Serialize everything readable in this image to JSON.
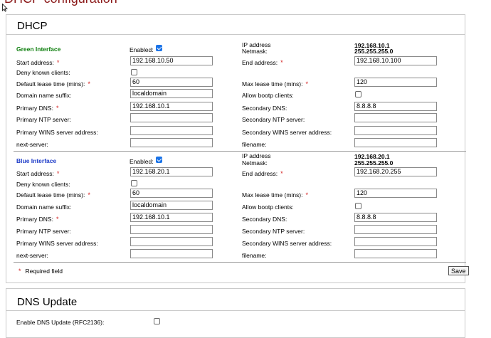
{
  "page_title": "DHCP configuration",
  "dhcp_box": {
    "title": "DHCP"
  },
  "green": {
    "heading": "Green Interface",
    "enabled_label": "Enabled:",
    "enabled": true,
    "ip_label": "IP address",
    "netmask_label": "Netmask:",
    "ip_value": "192.168.10.1",
    "netmask_value": "255.255.255.0",
    "start_label": "Start address:",
    "start_value": "192.168.10.50",
    "end_label": "End address:",
    "end_value": "192.168.10.100",
    "deny_label": "Deny known clients:",
    "deny": false,
    "default_lease_label": "Default lease time (mins):",
    "default_lease_value": "60",
    "max_lease_label": "Max lease time (mins):",
    "max_lease_value": "120",
    "domain_label": "Domain name suffix:",
    "domain_value": "localdomain",
    "bootp_label": "Allow bootp clients:",
    "bootp": false,
    "pdns_label": "Primary DNS:",
    "pdns_value": "192.168.10.1",
    "sdns_label": "Secondary DNS:",
    "sdns_value": "8.8.8.8",
    "pntp_label": "Primary NTP server:",
    "pntp_value": "",
    "sntp_label": "Secondary NTP server:",
    "sntp_value": "",
    "pwins_label": "Primary WINS server address:",
    "pwins_value": "",
    "swins_label": "Secondary WINS server address:",
    "swins_value": "",
    "next_label": "next-server:",
    "next_value": "",
    "filename_label": "filename:",
    "filename_value": ""
  },
  "blue": {
    "heading": "Blue Interface",
    "enabled_label": "Enabled:",
    "enabled": true,
    "ip_label": "IP address",
    "netmask_label": "Netmask:",
    "ip_value": "192.168.20.1",
    "netmask_value": "255.255.255.0",
    "start_label": "Start address:",
    "start_value": "192.168.20.1",
    "end_label": "End address:",
    "end_value": "192.168.20.255",
    "deny_label": "Deny known clients:",
    "deny": false,
    "default_lease_label": "Default lease time (mins):",
    "default_lease_value": "60",
    "max_lease_label": "Max lease time (mins):",
    "max_lease_value": "120",
    "domain_label": "Domain name suffix:",
    "domain_value": "localdomain",
    "bootp_label": "Allow bootp clients:",
    "bootp": false,
    "pdns_label": "Primary DNS:",
    "pdns_value": "192.168.10.1",
    "sdns_label": "Secondary DNS:",
    "sdns_value": "8.8.8.8",
    "pntp_label": "Primary NTP server:",
    "pntp_value": "",
    "sntp_label": "Secondary NTP server:",
    "sntp_value": "",
    "pwins_label": "Primary WINS server address:",
    "pwins_value": "",
    "swins_label": "Secondary WINS server address:",
    "swins_value": "",
    "next_label": "next-server:",
    "next_value": "",
    "filename_label": "filename:",
    "filename_value": ""
  },
  "required_star": "*",
  "required_note": "Required field",
  "save_label": "Save",
  "dns_box": {
    "title": "DNS Update",
    "enable_label": "Enable DNS Update (RFC2136):",
    "enable": false
  },
  "colors": {
    "accent_checkbox": "#1a73e8",
    "required": "#d42020",
    "green_heading": "#0a7d0a",
    "blue_heading": "#1e3cc8"
  }
}
